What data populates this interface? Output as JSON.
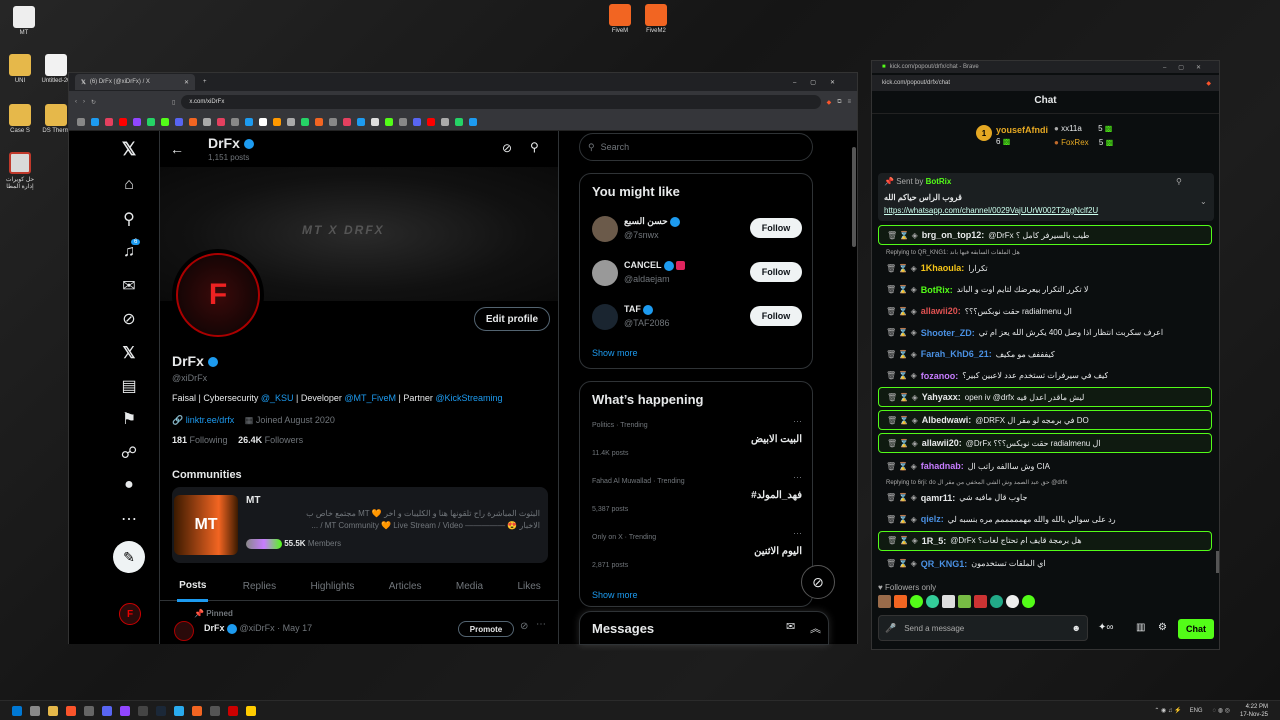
{
  "desktop": {
    "icons": [
      {
        "label": "MT"
      },
      {
        "label": "UNI"
      },
      {
        "label": "Untitled-20"
      },
      {
        "label": "Case S"
      },
      {
        "label": "DS Therm"
      },
      {
        "label": "حل كويرات إدارة المطا"
      },
      {
        "label": "FiveM"
      },
      {
        "label": "FiveM2"
      }
    ]
  },
  "browser": {
    "tab_title": "(6) DrFx (@xiDrFx) / X",
    "url": "x.com/xiDrFx"
  },
  "profile": {
    "header_name": "DrFx",
    "header_posts": "1,151 posts",
    "banner_text": "MT X DRFX",
    "name": "DrFx",
    "handle": "@xiDrFx",
    "edit_button": "Edit profile",
    "bio_plain": "Faisal | Cybersecurity ",
    "bio_mention1": "@_KSU",
    "bio_mid1": " | Developer ",
    "bio_mention2": "@MT_FiveM",
    "bio_mid2": " | Partner ",
    "bio_mention3": "@KickStreaming",
    "link": "linktr.ee/drfx",
    "joined": "Joined August 2020",
    "following_count": "181",
    "following_label": "Following",
    "followers_count": "26.4K",
    "followers_label": "Followers",
    "communities_title": "Communities",
    "community_name": "MT",
    "community_line1": "البثوث المباشرة راح تلقونها هنا و الكليبات و اخر 🧡 MT مجتمع خاص ب",
    "community_line2": "الاخبار 😍 ————— MT Community 🧡 Live Stream / Video / ...",
    "community_members": "55.5K",
    "community_members_label": "Members",
    "tabs": [
      "Posts",
      "Replies",
      "Highlights",
      "Articles",
      "Media",
      "Likes"
    ],
    "pinned_label": "Pinned",
    "post_name": "DrFx",
    "post_meta": "@xiDrFx · May 17",
    "promote_button": "Promote"
  },
  "nav": {
    "notifications_badge": "6"
  },
  "sidebar": {
    "search_placeholder": "Search",
    "might_like_title": "You might like",
    "suggestions": [
      {
        "name": "حسن السبع",
        "handle": "@7snwx",
        "button": "Follow"
      },
      {
        "name": "CANCEL",
        "handle": "@aldaejam",
        "button": "Follow"
      },
      {
        "name": "TAF",
        "handle": "@TAF2086",
        "button": "Follow"
      }
    ],
    "show_more": "Show more",
    "happening_title": "What’s happening",
    "trends": [
      {
        "context": "Politics · Trending",
        "topic": "البيت الابيض",
        "count": "11.4K posts"
      },
      {
        "context": "Fahad Al Muwallad · Trending",
        "topic": "#فهد_المولد",
        "count": "5,387 posts"
      },
      {
        "context": "Only on X · Trending",
        "topic": "اليوم الاثنين",
        "count": "2,871 posts"
      }
    ],
    "show_more2": "Show more",
    "messages_title": "Messages"
  },
  "kick": {
    "url": "kick.com/popout/drfx/chat",
    "window_title": "kick.com/popout/drfx/chat - Brave",
    "chat_title": "Chat",
    "leaders": [
      {
        "rank": "1",
        "name": "yousefAfndi",
        "count": "6"
      },
      {
        "rank": "",
        "name": "xx11a",
        "count": "5"
      },
      {
        "rank": "",
        "name": "FoxRex",
        "count": "5"
      }
    ],
    "pinned_sent_by": "Sent by",
    "pinned_sender": "BotRix",
    "pinned_text": "قروب الراس حياكم الله",
    "pinned_link": "https://whatsapp.com/channel/0029VajUUrW002T2agNclf2U",
    "messages": [
      {
        "user": "brg_on_top12:",
        "text": "@DrFx طيب بالسيرفر كامل ؟",
        "color": "#e7e9ea",
        "hl": true,
        "reply": ""
      },
      {
        "user": "1Khaoula:",
        "text": "تكرارا",
        "color": "#f5c518",
        "hl": false,
        "reply": "Replying to QR_KNG1: هل الملفات السابقه فيها باند"
      },
      {
        "user": "BotRix:",
        "text": "لا تكرر التكرار بيعرضك لتايم اوت و الباند",
        "color": "#53fc18",
        "hl": false,
        "reply": ""
      },
      {
        "user": "allawii20:",
        "text": "حقت نوبكس؟؟؟ radialmenu ال",
        "color": "#e05252",
        "hl": false,
        "reply": ""
      },
      {
        "user": "Shooter_ZD:",
        "text": "اعرف سكربت انتظار اذا وصل 400 يكرش الله يعز ام تي",
        "color": "#4a90e2",
        "hl": false,
        "reply": ""
      },
      {
        "user": "Farah_KhD6_21:",
        "text": "كيفففف مو مكيف",
        "color": "#4a90e2",
        "hl": false,
        "reply": ""
      },
      {
        "user": "fozanoo:",
        "text": "كيف في سيرفرات تستخدم عدد لاعبين كبير؟",
        "color": "#c77dff",
        "hl": false,
        "reply": ""
      },
      {
        "user": "Yahyaxx:",
        "text": "open iv @drfx ليش ماقدر اعدل فيه",
        "color": "#e7e9ea",
        "hl": true,
        "reply": ""
      },
      {
        "user": "Albedwawi:",
        "text": "@DRFX في برمجه لو مقر ال DO",
        "color": "#e7e9ea",
        "hl": true,
        "reply": ""
      },
      {
        "user": "allawii20:",
        "text": "@DrFx حقت نوبكس؟؟؟ radialmenu ال",
        "color": "#e7e9ea",
        "hl": true,
        "reply": ""
      },
      {
        "user": "fahadnab:",
        "text": "وش ساالفه راتب ال CIA",
        "color": "#c77dff",
        "hl": false,
        "reply": ""
      },
      {
        "user": "qamr11:",
        "text": "جاوب قال مافيه شي",
        "color": "#e7e9ea",
        "hl": false,
        "reply": "Replying to 6rji: do حق عبد الصمد وش الشي المخفي من مقر ال @drfx"
      },
      {
        "user": "qielz:",
        "text": "رد على سوالي بالله والله مهمممممم مره بنسبه لي",
        "color": "#4a90e2",
        "hl": false,
        "reply": ""
      },
      {
        "user": "1R_5:",
        "text": "@DrFx هل برمجة قايف ام تحتاج لغات؟",
        "color": "#e7e9ea",
        "hl": true,
        "reply": ""
      },
      {
        "user": "QR_KNG1:",
        "text": "اي الملفات تستخدمون",
        "color": "#4a90e2",
        "hl": false,
        "reply": ""
      }
    ],
    "followers_only": "Followers only",
    "input_placeholder": "Send a message",
    "chat_button": "Chat"
  },
  "taskbar": {
    "lang": "ENG",
    "time": "4:22 PM",
    "date": "17-Nov-25"
  },
  "colors": {
    "kick_green": "#53fc18",
    "x_blue": "#1d9bf0"
  }
}
